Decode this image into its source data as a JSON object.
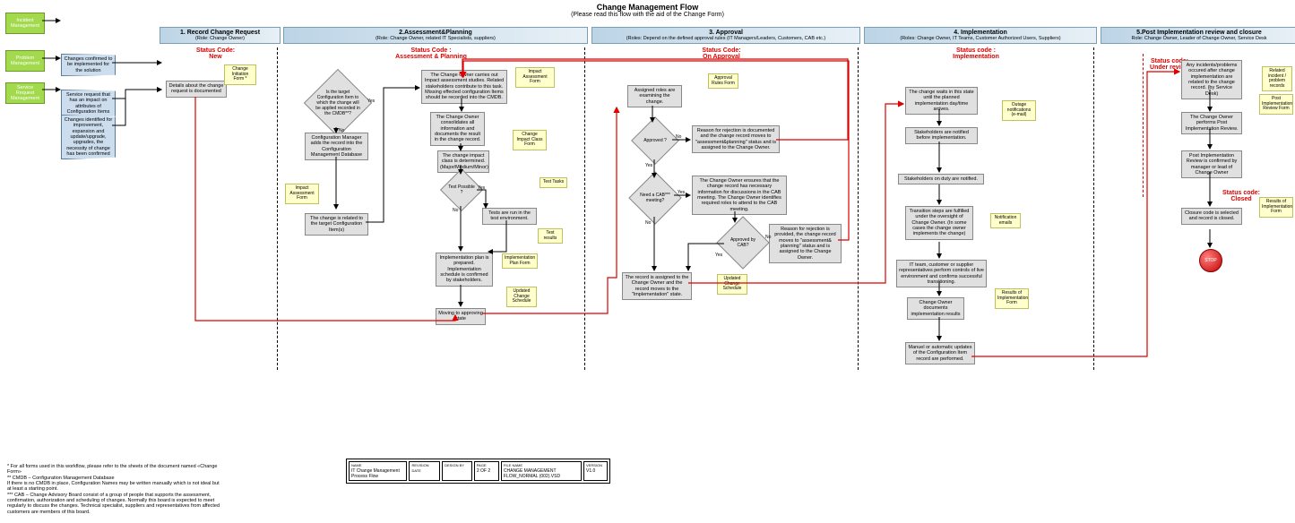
{
  "title": "Change Management Flow",
  "subtitle": "(Please read this flow with the aid of the Change Form)",
  "phases": {
    "p1": {
      "title": "1. Record Change Request",
      "sub": "(Role: Change Owner)"
    },
    "p2": {
      "title": "2.Assessment&Planning",
      "sub": "(Role: Change Owner, related IT Specialists, suppliers)"
    },
    "p3": {
      "title": "3. Approval",
      "sub": "(Roles: Depend on the defined approval rules (IT Managers/Leaders, Customers, CAB etc.)"
    },
    "p4": {
      "title": "4. Implementation",
      "sub": "(Roles: Change Owner, IT Teams, Customer Authorized Users, Suppliers)"
    },
    "p5": {
      "title": "5.Post Implementation review and closure",
      "sub": "Role: Change Owner, Leader of Change Owner, Service Desk"
    }
  },
  "status": {
    "s1a": "Status Code:",
    "s1b": "New",
    "s2a": "Status Code :",
    "s2b": "Assessment & Planning",
    "s3a": "Status Code:",
    "s3b": "On Approval",
    "s4a": "Status code :",
    "s4b": "Implementation",
    "s5a": "Status code:",
    "s5b": "Under review",
    "s6a": "Status code:",
    "s6b": "Closed"
  },
  "left": {
    "l1": "Incident Management",
    "l2": "Problem Management",
    "l3": "Service Request Management",
    "i1": "Changes confirmed to be implemented for the solution",
    "i2": "Service request that has an impact on attributes of Configuration Items",
    "i3": "Changes identified for improvement, expansion and update/upgrade, upgrades, the necessity of change has been confirmed"
  },
  "boxes": {
    "b1": "Details about the change request is documented",
    "b2": "Configuration Manager adds the record into the Configuration Management Database",
    "b3": "The change is related to the target Configuration Item(s)",
    "b4": "The Change Owner carries out Impact assessment studies. Related stakeholders contribute to this task. Missing effected configuration Items should be recorded into the CMDB.",
    "b5": "The Change Owner consolidates all information and documents the result in the change record.",
    "b6": "The change impact class is determined. (Major/Medium/Minor)",
    "b7": "Tests are run in the test environment.",
    "b8": "Implementation plan is prepared. Implementation schedule is confirmed by stakeholders.",
    "b9": "Moving to approving state",
    "b10": "Assigned roles are examining the change.",
    "b11": "Reason for rejection is documented and the change record moves to \"assessment&planning\" status and is assigned to the Change Owner.",
    "b12": "The Change Owner ensures that the change record has necessary information for discussions in the CAB meeting. The Change Owner identifies required roles to attend to the CAB meeting.",
    "b13": "Reason for rejection is provided, the change record moves to \"assessment& planning\" status and is assigned to the Change Owner.",
    "b14": "The record is assigned to the Change Owner and the record moves to the \"Implementation\" state.",
    "b15": "The change waits in this state until the planned implementation day/time arrives.",
    "b16": "Stakeholders are notified before implementation.",
    "b17": "Stakeholders on duty are notified.",
    "b18": "Transition steps are fulfilled under the oversight of Change Owner. (In some cases the change owner implements the change)",
    "b19": "IT team, customer or supplier representatives perform controls of live environment and confirms successful transitioning.",
    "b20": "Change Owner documents implementation results",
    "b21": "Manuel or automatic updates of the Configuration Item record are performed.",
    "b22": "Any incidents/problems occured after change implementation are related to the change record. (by Service Desk)",
    "b23": "The Change Owner performs Post Implementation Review.",
    "b24": "Post Implementation Review is confirmed by manager or lead of Change Owner",
    "b25": "Closure code is selected and record is closed."
  },
  "diamonds": {
    "d1": "Is the target Configuration Item to which the change will be applied recorded in the CMDB**?",
    "d2": "Test Possible ?",
    "d3": "Approved ?",
    "d4": "Need a CAB*** meeting?",
    "d5": "Approved by CAB?"
  },
  "notes": {
    "n1": "Change Initiation Form *",
    "n2": "Impact Assessment Form",
    "n3": "Impact Assessment Form",
    "n4": "Change Impact Class Form",
    "n5": "Test Tasks",
    "n6": "Test results",
    "n7": "Implementation Plan Form",
    "n8": "Updated Change Schedule",
    "n9": "Approval Rules Form",
    "n10": "Updated Change Schedule",
    "n11": "Outage notifications (e-mail)",
    "n12": "Notification emails",
    "n13": "Results of Implementation Form",
    "n14": "Related incident / problem records",
    "n15": "Post Implementation Review Form",
    "n16": "Results of Implementation Form"
  },
  "labels": {
    "yes": "Yes",
    "no": "No",
    "stop": "STOP"
  },
  "footer": {
    "name_hdr": "NAME",
    "name": "IT Change Management Process Flow",
    "rev_hdr": "REVISION DATE",
    "rev": "",
    "design_hdr": "DESIGN BY",
    "design": "",
    "page_hdr": "PAGE",
    "page": "2 OF 2",
    "file_hdr": "FILE NAME",
    "file": "CHANGE MANAGEMENT FLOW_NORMAL (002).VSD",
    "ver_hdr": "VERSION",
    "ver": "V1.0"
  },
  "foot_text": "* For all forms used in this workflow, please refer to the sheets of the document named «Change Form»\n** CMDB – Configuration Management Database\nIf there is no CMDB in place, Configuration Names may be written manually which is not ideal but at least a starting point.\n*** CAB – Change Advisory Board consist of a group of people that supports the assessment, confirmation, authorization and scheduling of changes. Normally this board is expected to meet regularly to discuss the changes. Technical specialist, suppliers and representatives from affected customers are members of this board."
}
